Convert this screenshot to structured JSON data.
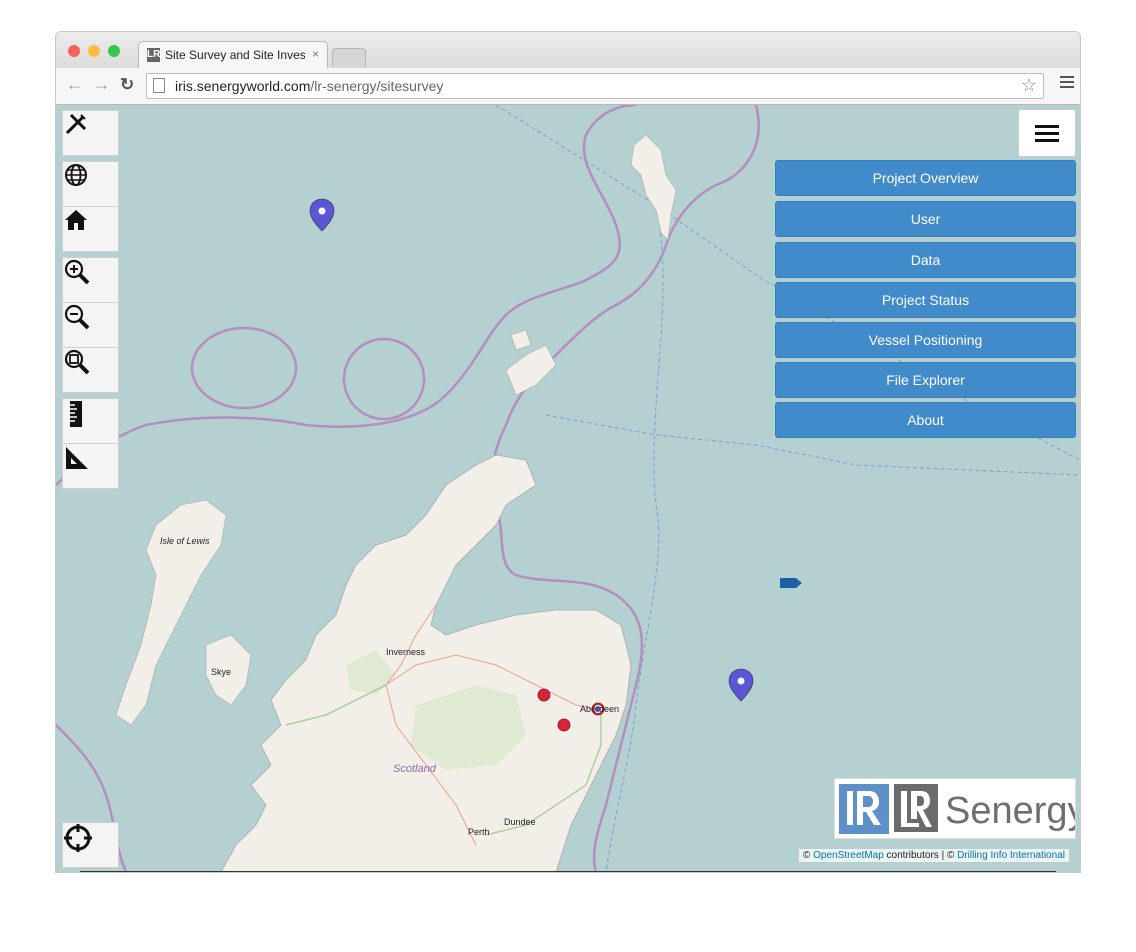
{
  "browser": {
    "tab_title": "Site Survey and Site Invest",
    "tab_close": "×",
    "favicon_text": "LR",
    "url_host": "iris.senergyworld.com",
    "url_path": "/lr-senergy/sitesurvey",
    "traffic_light_colors": [
      "#fc605c",
      "#fdbc40",
      "#34c84a"
    ]
  },
  "map_tools": [
    {
      "name": "draw-tools-icon",
      "glyph": "✎"
    },
    {
      "name": "globe-icon",
      "glyph": "🌐"
    },
    {
      "name": "home-icon",
      "glyph": "⌂"
    },
    {
      "name": "zoom-in-icon",
      "glyph": "+"
    },
    {
      "name": "zoom-out-icon",
      "glyph": "−"
    },
    {
      "name": "zoom-extent-icon",
      "glyph": "□"
    },
    {
      "name": "ruler-icon",
      "glyph": "ruler"
    },
    {
      "name": "set-square-icon",
      "glyph": "triangle"
    }
  ],
  "side_menu": {
    "items": [
      {
        "label": "Project Overview"
      },
      {
        "label": "User"
      },
      {
        "label": "Data"
      },
      {
        "label": "Project Status"
      },
      {
        "label": "Vessel Positioning"
      },
      {
        "label": "File Explorer"
      },
      {
        "label": "About"
      }
    ],
    "button_color": "#428bca"
  },
  "map": {
    "sea_color": "#b5d0d0",
    "land_color": "#f2efe9",
    "place_names": {
      "lewis": "Isle of Lewis",
      "skye": "Skye",
      "inverness": "Inverness",
      "aberdeen": "Aberdeen",
      "scotland": "Scotland",
      "perth": "Perth",
      "dundee": "Dundee"
    }
  },
  "logo": {
    "text": "Senergy",
    "lr_mark": "LR"
  },
  "attribution": {
    "prefix": "©",
    "osm_link": "OpenStreetMap",
    "contributors": "contributors | ©",
    "drilling_link": "Drilling Info International"
  }
}
